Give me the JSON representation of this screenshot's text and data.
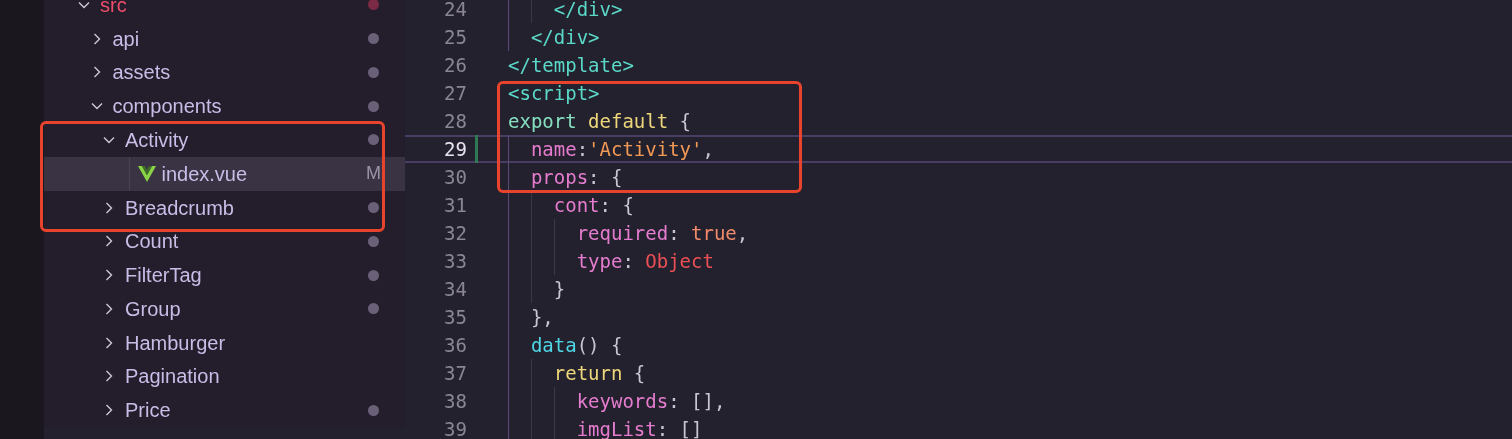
{
  "explorer": {
    "tree": [
      {
        "label": "src",
        "kind": "folder",
        "expanded": true,
        "error": true,
        "dot": true,
        "children": [
          {
            "label": "api",
            "kind": "folder",
            "expanded": false,
            "error": false,
            "dot": true
          },
          {
            "label": "assets",
            "kind": "folder",
            "expanded": false,
            "error": false,
            "dot": true
          },
          {
            "label": "components",
            "kind": "folder",
            "expanded": true,
            "error": false,
            "dot": true,
            "children": [
              {
                "label": "Activity",
                "kind": "folder",
                "expanded": true,
                "error": false,
                "dot": true,
                "children": [
                  {
                    "label": "index.vue",
                    "kind": "vue",
                    "selected": true,
                    "badge": "M"
                  }
                ]
              },
              {
                "label": "Breadcrumb",
                "kind": "folder",
                "expanded": false,
                "error": false,
                "dot": true
              },
              {
                "label": "Count",
                "kind": "folder",
                "expanded": false,
                "error": false,
                "dot": true
              },
              {
                "label": "FilterTag",
                "kind": "folder",
                "expanded": false,
                "error": false,
                "dot": true
              },
              {
                "label": "Group",
                "kind": "folder",
                "expanded": false,
                "error": false,
                "dot": true
              },
              {
                "label": "Hamburger",
                "kind": "folder",
                "expanded": false,
                "error": false,
                "dot": false
              },
              {
                "label": "Pagination",
                "kind": "folder",
                "expanded": false,
                "error": false,
                "dot": false
              },
              {
                "label": "Price",
                "kind": "folder",
                "expanded": false,
                "error": false,
                "dot": true
              }
            ]
          }
        ]
      }
    ]
  },
  "editor": {
    "lines": [
      {
        "number": "24",
        "selected": false,
        "tokens": [
          {
            "text": "    </div>",
            "kind": "tag"
          }
        ]
      },
      {
        "number": "25",
        "selected": false,
        "tokens": [
          {
            "text": "  </div>",
            "kind": "tag"
          }
        ]
      },
      {
        "number": "26",
        "selected": false,
        "tokens": [
          {
            "text": "</template>",
            "kind": "tag"
          }
        ]
      },
      {
        "number": "27",
        "selected": false,
        "tokens": [
          {
            "text": "<script>",
            "kind": "tag"
          }
        ]
      },
      {
        "number": "28",
        "selected": false,
        "tokens": [
          {
            "text": "export",
            "kind": "export"
          },
          {
            "text": " default",
            "kind": "keyword"
          },
          {
            "text": " {",
            "kind": "punct"
          }
        ]
      },
      {
        "number": "29",
        "selected": true,
        "tokens": [
          {
            "text": "  name",
            "kind": "prop"
          },
          {
            "text": ":",
            "kind": "punct"
          },
          {
            "text": "'Activity'",
            "kind": "string"
          },
          {
            "text": ",",
            "kind": "punct"
          }
        ]
      },
      {
        "number": "30",
        "selected": false,
        "tokens": [
          {
            "text": "  props",
            "kind": "prop"
          },
          {
            "text": ": {",
            "kind": "punct"
          }
        ]
      },
      {
        "number": "31",
        "selected": false,
        "tokens": [
          {
            "text": "    cont",
            "kind": "prop"
          },
          {
            "text": ": {",
            "kind": "punct"
          }
        ]
      },
      {
        "number": "32",
        "selected": false,
        "tokens": [
          {
            "text": "      required",
            "kind": "prop"
          },
          {
            "text": ": ",
            "kind": "punct"
          },
          {
            "text": "true",
            "kind": "bool"
          },
          {
            "text": ",",
            "kind": "punct"
          }
        ]
      },
      {
        "number": "33",
        "selected": false,
        "tokens": [
          {
            "text": "      type",
            "kind": "prop"
          },
          {
            "text": ": ",
            "kind": "punct"
          },
          {
            "text": "Object",
            "kind": "type"
          }
        ]
      },
      {
        "number": "34",
        "selected": false,
        "tokens": [
          {
            "text": "    }",
            "kind": "punct"
          }
        ]
      },
      {
        "number": "35",
        "selected": false,
        "tokens": [
          {
            "text": "  },",
            "kind": "punct"
          }
        ]
      },
      {
        "number": "36",
        "selected": false,
        "tokens": [
          {
            "text": "  data",
            "kind": "func"
          },
          {
            "text": "() {",
            "kind": "punct"
          }
        ]
      },
      {
        "number": "37",
        "selected": false,
        "tokens": [
          {
            "text": "    return",
            "kind": "keyword"
          },
          {
            "text": " {",
            "kind": "punct"
          }
        ]
      },
      {
        "number": "38",
        "selected": false,
        "tokens": [
          {
            "text": "      keywords",
            "kind": "prop"
          },
          {
            "text": ": [],",
            "kind": "punct"
          }
        ]
      },
      {
        "number": "39",
        "selected": false,
        "tokens": [
          {
            "text": "      imgList",
            "kind": "prop"
          },
          {
            "text": ": []",
            "kind": "punct"
          }
        ]
      }
    ]
  }
}
